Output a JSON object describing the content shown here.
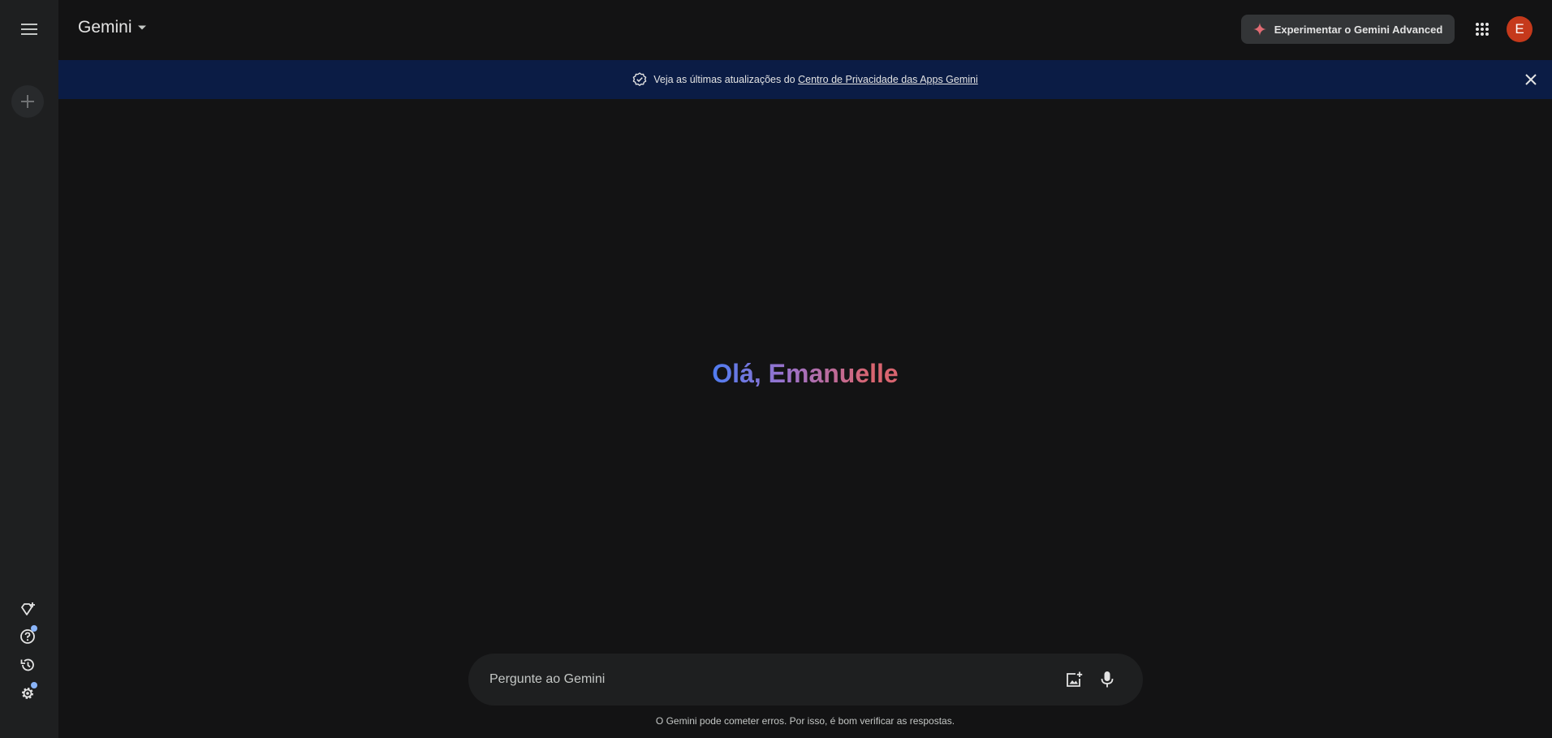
{
  "app": {
    "title": "Gemini"
  },
  "header": {
    "brand": "Gemini",
    "advanced_button": "Experimentar o Gemini Advanced",
    "avatar_initial": "E"
  },
  "banner": {
    "text_prefix": "Veja as últimas atualizações do ",
    "link_text": "Centro de Privacidade das Apps Gemini"
  },
  "greeting": {
    "text": "Olá, Emanuelle"
  },
  "prompt": {
    "placeholder": "Pergunte ao Gemini",
    "value": ""
  },
  "footer": {
    "disclaimer": "O Gemini pode cometer erros. Por isso, é bom verificar as respostas."
  },
  "sidebar": {
    "icons": [
      "menu-icon",
      "plus-icon",
      "gem-manager-icon",
      "help-icon",
      "history-icon",
      "settings-icon"
    ]
  },
  "colors": {
    "background": "#131314",
    "sidebar": "#1e1f20",
    "banner": "#0b1c45",
    "avatar": "#c5391b",
    "badge_dot": "#8ab4f8",
    "gradient_start": "#4f7cf0",
    "gradient_mid": "#9b72cb",
    "gradient_end": "#d96570"
  }
}
